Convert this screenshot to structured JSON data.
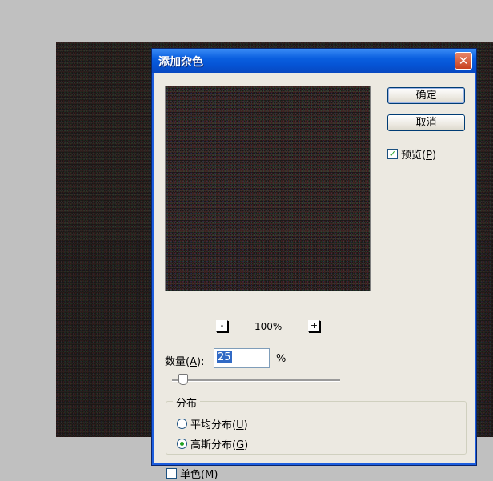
{
  "dialog": {
    "title": "添加杂色",
    "close_symbol": "✕",
    "ok_label": "确定",
    "cancel_label": "取消",
    "preview_label": "预览",
    "preview_mnemonic": "P",
    "preview_checked": true,
    "zoom_out_symbol": "-",
    "zoom_in_symbol": "+",
    "zoom_level": "100%",
    "amount_label": "数量",
    "amount_mnemonic": "A",
    "amount_value": "25",
    "amount_unit": "%",
    "amount_slider_fraction": 0.0625,
    "distribution_legend": "分布",
    "uniform_label": "平均分布",
    "uniform_mnemonic": "U",
    "uniform_selected": false,
    "gaussian_label": "高斯分布",
    "gaussian_mnemonic": "G",
    "gaussian_selected": true,
    "mono_label": "单色",
    "mono_mnemonic": "M",
    "mono_checked": false
  },
  "colors": {
    "titlebar": "#0553d4",
    "check_mark": "#21a121",
    "selection": "#316ac5",
    "close_button": "#c8401e"
  }
}
